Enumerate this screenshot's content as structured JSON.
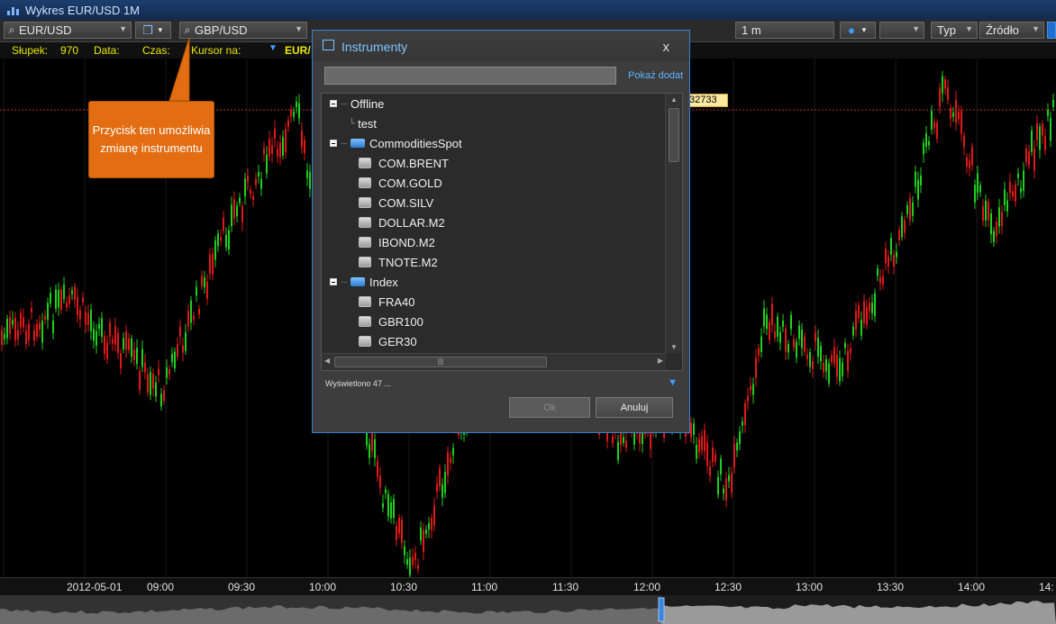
{
  "window": {
    "title": "Wykres EUR/USD 1M"
  },
  "toolbar": {
    "symbol1": "EUR/USD",
    "symbol2": "GBP/USD",
    "interval": "1 m",
    "type_label": "Typ",
    "source_label": "Źródło"
  },
  "status": {
    "bar_label": "Słupek:",
    "bar_value": "970",
    "date_label": "Data:",
    "time_label": "Czas:",
    "cursor_label": "Kursor na:",
    "cursor_value": "EUR/"
  },
  "price_tag": "32733",
  "callout": {
    "text": "Przycisk ten umożliwia zmianę instrumentu"
  },
  "time_axis": [
    "2012-05-01",
    "09:00",
    "09:30",
    "10:00",
    "10:30",
    "11:00",
    "11:30",
    "12:00",
    "12:30",
    "13:00",
    "13:30",
    "14:00",
    "14:"
  ],
  "dialog": {
    "title": "Instrumenty",
    "close": "x",
    "show_more": "Pokaż dodat",
    "status": "Wyświetlono 47 ...",
    "ok": "Ok",
    "cancel": "Anuluj",
    "groups": [
      {
        "name": "Offline",
        "items": [
          "test"
        ],
        "icon": "none"
      },
      {
        "name": "CommoditiesSpot",
        "items": [
          "COM.BRENT",
          "COM.GOLD",
          "COM.SILV",
          "DOLLAR.M2",
          "IBOND.M2",
          "TNOTE.M2"
        ],
        "icon": "folder-icon"
      },
      {
        "name": "Index",
        "items": [
          "FRA40",
          "GBR100",
          "GER30"
        ],
        "icon": "folder-icon"
      }
    ]
  },
  "colors": {
    "up": "#1fd11f",
    "down": "#e01919",
    "accent": "#3a7fd0",
    "callout": "#e26d12"
  }
}
